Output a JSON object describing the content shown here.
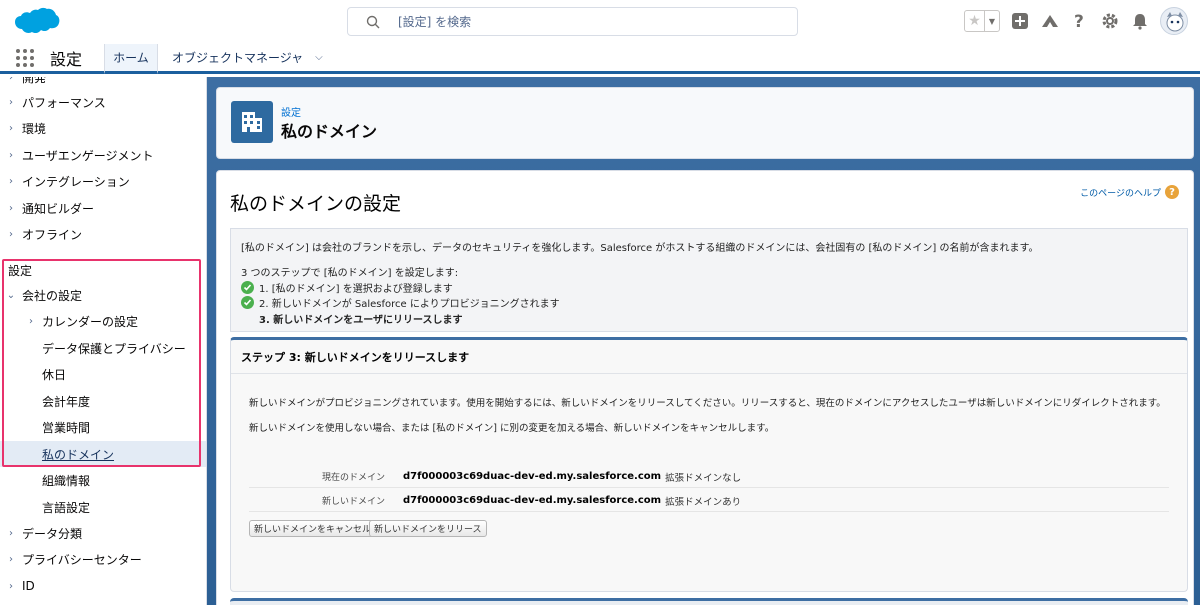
{
  "header": {
    "search_placeholder": "[設定] を検索"
  },
  "nav": {
    "app_name": "設定",
    "tabs": [
      {
        "label": "ホーム"
      },
      {
        "label": "オブジェクトマネージャ"
      }
    ]
  },
  "sidebar": {
    "top_items": [
      {
        "label": "開発"
      },
      {
        "label": "パフォーマンス"
      },
      {
        "label": "環境"
      },
      {
        "label": "ユーザエンゲージメント"
      },
      {
        "label": "インテグレーション"
      },
      {
        "label": "通知ビルダー"
      },
      {
        "label": "オフライン"
      }
    ],
    "section_label": "設定",
    "company_settings": {
      "label": "会社の設定",
      "children": [
        {
          "label": "カレンダーの設定"
        },
        {
          "label": "データ保護とプライバシー"
        },
        {
          "label": "休日"
        },
        {
          "label": "会計年度"
        },
        {
          "label": "営業時間"
        },
        {
          "label": "私のドメイン"
        },
        {
          "label": "組織情報"
        },
        {
          "label": "言語設定"
        }
      ]
    },
    "bottom_items": [
      {
        "label": "データ分類"
      },
      {
        "label": "プライバシーセンター"
      },
      {
        "label": "ID"
      }
    ]
  },
  "page_header": {
    "breadcrumb": "設定",
    "title": "私のドメイン"
  },
  "content": {
    "title": "私のドメインの設定",
    "help_link": "このページのヘルプ",
    "info": {
      "description": "[私のドメイン] は会社のブランドを示し、データのセキュリティを強化します。Salesforce がホストする組織のドメインには、会社固有の [私のドメイン] の名前が含まれます。",
      "steps_intro": "3 つのステップで [私のドメイン] を設定します:",
      "steps": [
        {
          "label": "1. [私のドメイン] を選択および登録します",
          "done": true
        },
        {
          "label": "2. 新しいドメインが Salesforce によりプロビジョニングされます",
          "done": true
        },
        {
          "label": "3. 新しいドメインをユーザにリリースします",
          "done": false
        }
      ]
    },
    "step3": {
      "title": "ステップ 3: 新しいドメインをリリースします",
      "para1": "新しいドメインがプロビジョニングされています。使用を開始するには、新しいドメインをリリースしてください。リリースすると、現在のドメインにアクセスしたユーザは新しいドメインにリダイレクトされます。",
      "para2": "新しいドメインを使用しない場合、または [私のドメイン] に別の変更を加える場合、新しいドメインをキャンセルします。",
      "current_domain_label": "現在のドメイン",
      "current_domain_value": "d7f000003c69duac-dev-ed.my.salesforce.com",
      "current_domain_note": "拡張ドメインなし",
      "new_domain_label": "新しいドメイン",
      "new_domain_value": "d7f000003c69duac-dev-ed.my.salesforce.com",
      "new_domain_note": "拡張ドメインあり",
      "cancel_button": "新しいドメインをキャンセル",
      "release_button": "新しいドメインをリリース"
    }
  },
  "colors": {
    "brand": "#00a1e0",
    "accent": "#1b5f9e",
    "highlight": "#e8336c",
    "success": "#4bb04e",
    "help": "#e8a33a"
  }
}
